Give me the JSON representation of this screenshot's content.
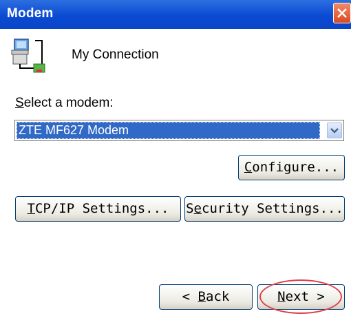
{
  "window": {
    "title": "Modem"
  },
  "connection": {
    "name": "My Connection",
    "icon": "network-computer-icon"
  },
  "modem_select": {
    "label_prefix": "",
    "label_accel": "S",
    "label_rest": "elect a modem:",
    "selected_value": "ZTE MF627 Modem"
  },
  "buttons": {
    "configure": {
      "accel": "C",
      "rest": "onfigure..."
    },
    "tcpip": {
      "accel": "T",
      "rest": "CP/IP Settings..."
    },
    "security_pre": "S",
    "security_accel": "e",
    "security_rest": "curity Settings...",
    "back_pre": "< ",
    "back_accel": "B",
    "back_rest": "ack",
    "next_accel": "N",
    "next_rest": "ext >"
  },
  "colors": {
    "titlebar": "#0a4ad2",
    "selection": "#3169c6",
    "highlight": "#e0404a"
  }
}
